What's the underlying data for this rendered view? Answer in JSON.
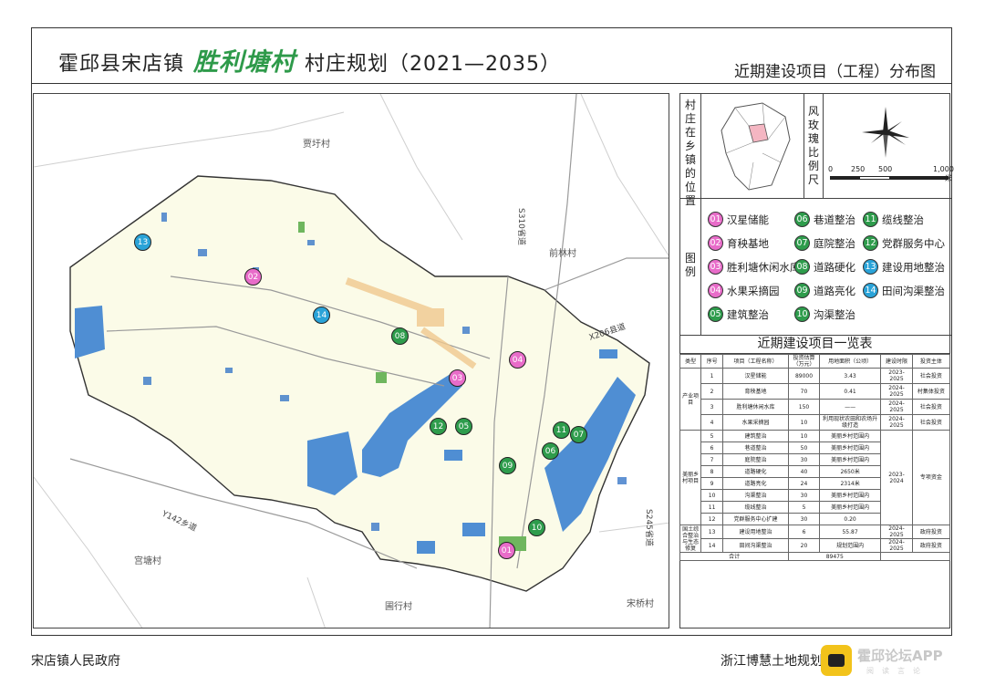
{
  "header": {
    "title_prefix": "霍邱县宋店镇",
    "village": "胜利塘村",
    "title_suffix": "村庄规划（2021—2035）",
    "subtitle": "近期建设项目（工程）分布图"
  },
  "side": {
    "location_label": "村庄在乡镇的位置",
    "wind_label": "风玫瑰比例尺",
    "scale_ticks": [
      "0",
      "250",
      "500",
      "1,000"
    ],
    "scale_unit": "米",
    "legend_label": "图例",
    "legend": [
      {
        "num": "01",
        "label": "汉星储能",
        "color": "pink"
      },
      {
        "num": "02",
        "label": "育秧基地",
        "color": "pink"
      },
      {
        "num": "03",
        "label": "胜利塘休闲水库",
        "color": "pink"
      },
      {
        "num": "04",
        "label": "水果采摘园",
        "color": "pink"
      },
      {
        "num": "05",
        "label": "建筑整治",
        "color": "green"
      },
      {
        "num": "06",
        "label": "巷道整治",
        "color": "green"
      },
      {
        "num": "07",
        "label": "庭院整治",
        "color": "green"
      },
      {
        "num": "08",
        "label": "道路硬化",
        "color": "green"
      },
      {
        "num": "09",
        "label": "道路亮化",
        "color": "green"
      },
      {
        "num": "10",
        "label": "沟渠整治",
        "color": "green"
      },
      {
        "num": "11",
        "label": "缆线整治",
        "color": "green"
      },
      {
        "num": "12",
        "label": "党群服务中心",
        "color": "green"
      },
      {
        "num": "13",
        "label": "建设用地整治",
        "color": "blue"
      },
      {
        "num": "14",
        "label": "田间沟渠整治",
        "color": "blue"
      }
    ]
  },
  "table": {
    "title": "近期建设项目一览表",
    "headers": [
      "类型",
      "序号",
      "项目（工程名称）",
      "投资估算（万元）",
      "用地面积（公顷）",
      "建设时限",
      "投资主体"
    ],
    "groups": [
      {
        "type": "产业项目",
        "rows": [
          [
            "1",
            "汉星储能",
            "89000",
            "3.43",
            "2023-2025",
            "社会投资"
          ],
          [
            "2",
            "育秧基地",
            "70",
            "0.41",
            "2024-2025",
            "村集体投资"
          ],
          [
            "3",
            "胜利塘休闲水库",
            "150",
            "——",
            "2024-2025",
            "社会投资"
          ],
          [
            "4",
            "水果采摘园",
            "10",
            "利用现状农田和农场升级打造",
            "2024-2025",
            "社会投资"
          ]
        ]
      },
      {
        "type": "美丽乡村项目",
        "period": "2023-2024",
        "funding": "专项资金",
        "rows": [
          [
            "5",
            "建筑整治",
            "10",
            "美丽乡村范围内"
          ],
          [
            "6",
            "巷道整治",
            "50",
            "美丽乡村范围内"
          ],
          [
            "7",
            "庭院整治",
            "30",
            "美丽乡村范围内"
          ],
          [
            "8",
            "道路硬化",
            "40",
            "2650米"
          ],
          [
            "9",
            "道路亮化",
            "24",
            "2314米"
          ],
          [
            "10",
            "沟渠整治",
            "30",
            "美丽乡村范围内"
          ],
          [
            "11",
            "缆线整治",
            "5",
            "美丽乡村范围内"
          ],
          [
            "12",
            "党群服务中心扩建",
            "30",
            "0.20"
          ]
        ]
      },
      {
        "type": "国土综合整治与生态修复",
        "rows": [
          [
            "13",
            "建设用地整治",
            "6",
            "55.87",
            "2024-2025",
            "政府投资"
          ],
          [
            "14",
            "田间沟渠整治",
            "20",
            "规划范围内",
            "2024-2025",
            "政府投资"
          ]
        ]
      }
    ],
    "total_label": "合计",
    "total_value": "89475"
  },
  "map": {
    "places": [
      "贾圩村",
      "前林村",
      "宫塘村",
      "圃行村",
      "宋桥村"
    ],
    "roads": [
      "S310省道",
      "X206县道",
      "Y142乡道",
      "S245省道"
    ]
  },
  "footer": {
    "left": "宋店镇人民政府",
    "right": "浙江博慧土地规划",
    "app_text": "霍邱论坛APP",
    "app_sub": "阅读言论"
  }
}
